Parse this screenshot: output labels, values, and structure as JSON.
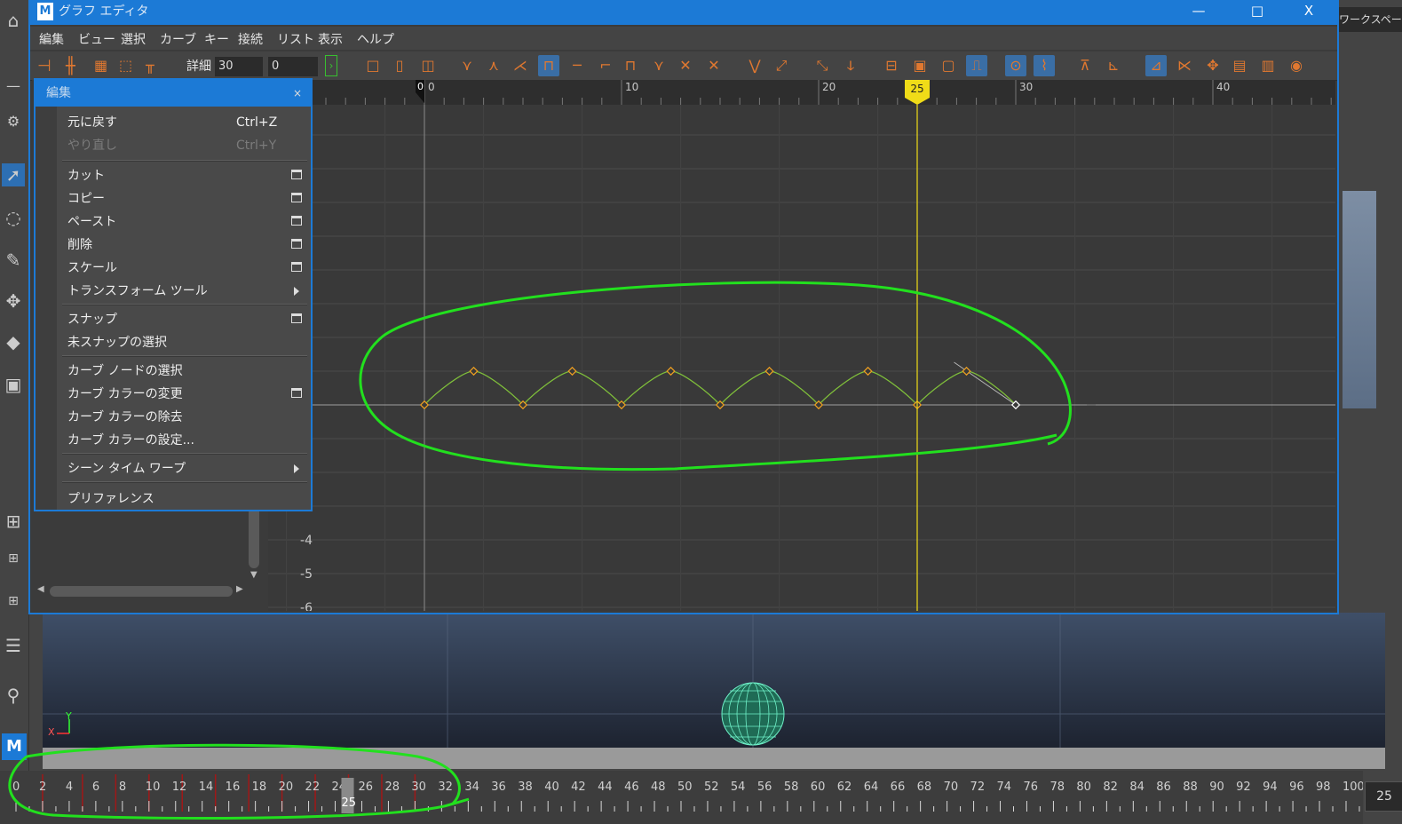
{
  "window": {
    "title": "グラフ エディタ",
    "app_logo": "M",
    "minimize": "—",
    "maximize": "□",
    "close": "X"
  },
  "menubar": [
    "編集",
    "ビュー",
    "選択",
    "カーブ",
    "キー",
    "接続",
    "リスト",
    "表示",
    "ヘルプ"
  ],
  "toolbar": {
    "detail_label": "詳細",
    "detail_value": "30",
    "value_field": "0"
  },
  "edit_menu": {
    "title": "編集",
    "close": "×",
    "groups": [
      [
        {
          "label": "元に戻す",
          "shortcut": "Ctrl+Z",
          "disabled": false
        },
        {
          "label": "やり直し",
          "shortcut": "Ctrl+Y",
          "disabled": true
        }
      ],
      [
        {
          "label": "カット",
          "option_box": true
        },
        {
          "label": "コピー",
          "option_box": true
        },
        {
          "label": "ペースト",
          "option_box": true
        },
        {
          "label": "削除",
          "option_box": true
        },
        {
          "label": "スケール",
          "option_box": true
        },
        {
          "label": "トランスフォーム ツール",
          "submenu": true
        }
      ],
      [
        {
          "label": "スナップ",
          "option_box": true
        },
        {
          "label": "未スナップの選択"
        }
      ],
      [
        {
          "label": "カーブ ノードの選択"
        },
        {
          "label": "カーブ カラーの変更",
          "option_box": true
        },
        {
          "label": "カーブ カラーの除去"
        },
        {
          "label": "カーブ カラーの設定..."
        }
      ],
      [
        {
          "label": "シーン タイム ワープ",
          "submenu": true
        }
      ],
      [
        {
          "label": "プリファレンス"
        }
      ]
    ]
  },
  "graph": {
    "ruler_ticks": [
      "0",
      "10",
      "20",
      "30",
      "40"
    ],
    "start_marker": "0",
    "current_frame": "25",
    "y_labels": [
      "-4",
      "-5",
      "-6"
    ],
    "curve_keys": [
      {
        "frame": 0,
        "value": 0
      },
      {
        "frame": 2.5,
        "value": 1
      },
      {
        "frame": 5,
        "value": 0
      },
      {
        "frame": 7.5,
        "value": 1
      },
      {
        "frame": 10,
        "value": 0
      },
      {
        "frame": 12.5,
        "value": 1
      },
      {
        "frame": 15,
        "value": 0
      },
      {
        "frame": 17.5,
        "value": 1
      },
      {
        "frame": 20,
        "value": 0
      },
      {
        "frame": 22.5,
        "value": 1
      },
      {
        "frame": 25,
        "value": 0
      },
      {
        "frame": 27.5,
        "value": 1
      },
      {
        "frame": 30,
        "value": 0
      }
    ],
    "colors": {
      "curve": "#7fbf3a",
      "key": "#f0a020",
      "selected_key": "#ffffff",
      "current_time": "#f0dc18",
      "annotation": "#22e01e"
    }
  },
  "viewport": {
    "axis_y": "Y",
    "axis_x": "X"
  },
  "timeline": {
    "labels": [
      "0",
      "2",
      "4",
      "6",
      "8",
      "10",
      "12",
      "14",
      "16",
      "18",
      "20",
      "22",
      "24",
      "26",
      "28",
      "30",
      "32",
      "34",
      "36",
      "38",
      "40",
      "42",
      "44",
      "46",
      "48",
      "50",
      "52",
      "54",
      "56",
      "58",
      "60",
      "62",
      "64",
      "66",
      "68",
      "70",
      "72",
      "74",
      "76",
      "78",
      "80",
      "82",
      "84",
      "86",
      "88",
      "90",
      "92",
      "94",
      "96",
      "98",
      "100"
    ],
    "current": "25",
    "end_field": "25",
    "key_frames": [
      2,
      5,
      7.5,
      10,
      12.5,
      15,
      17.5,
      20,
      22.5,
      25,
      27.5,
      30
    ]
  },
  "right_panel": {
    "tab_label": "ワークスペース"
  },
  "left_bar": {
    "logo": "M"
  }
}
